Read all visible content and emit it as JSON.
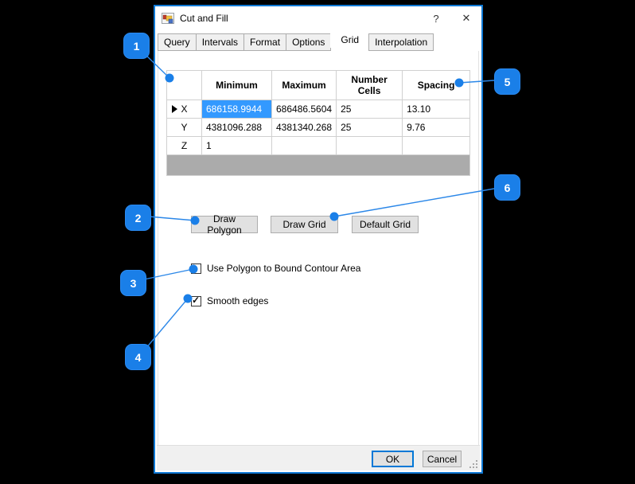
{
  "window": {
    "title": "Cut and Fill",
    "help_label": "?",
    "close_label": "✕"
  },
  "tabs": [
    {
      "label": "Query",
      "active": false
    },
    {
      "label": "Intervals",
      "active": false
    },
    {
      "label": "Format",
      "active": false
    },
    {
      "label": "Options",
      "active": false
    },
    {
      "label": "Grid",
      "active": true
    },
    {
      "label": "Interpolation",
      "active": false
    }
  ],
  "grid": {
    "columns": [
      "",
      "Minimum",
      "Maximum",
      "Number Cells",
      "Spacing"
    ],
    "rows": [
      {
        "header": "X",
        "cells": [
          "686158.9944",
          "686486.5604",
          "25",
          "13.10"
        ]
      },
      {
        "header": "Y",
        "cells": [
          "4381096.288",
          "4381340.268",
          "25",
          "9.76"
        ]
      },
      {
        "header": "Z",
        "cells": [
          "1",
          "",
          "",
          ""
        ]
      }
    ],
    "current_row": "X",
    "selection": {
      "row": "X",
      "column": "Minimum"
    }
  },
  "buttons": {
    "draw_polygon": "Draw Polygon",
    "draw_grid": "Draw Grid",
    "default_grid": "Default Grid",
    "ok": "OK",
    "cancel": "Cancel"
  },
  "checkboxes": [
    {
      "label": "Use Polygon to Bound Contour Area",
      "checked": false
    },
    {
      "label": "Smooth edges",
      "checked": true
    }
  ],
  "callouts": [
    {
      "label": "1"
    },
    {
      "label": "2"
    },
    {
      "label": "3"
    },
    {
      "label": "4"
    },
    {
      "label": "5"
    },
    {
      "label": "6"
    }
  ],
  "colors": {
    "accent": "#0078d7",
    "callout_blue": "#1a7fe8",
    "cell_selection": "#3399ff",
    "grid_filler": "#ababab"
  }
}
